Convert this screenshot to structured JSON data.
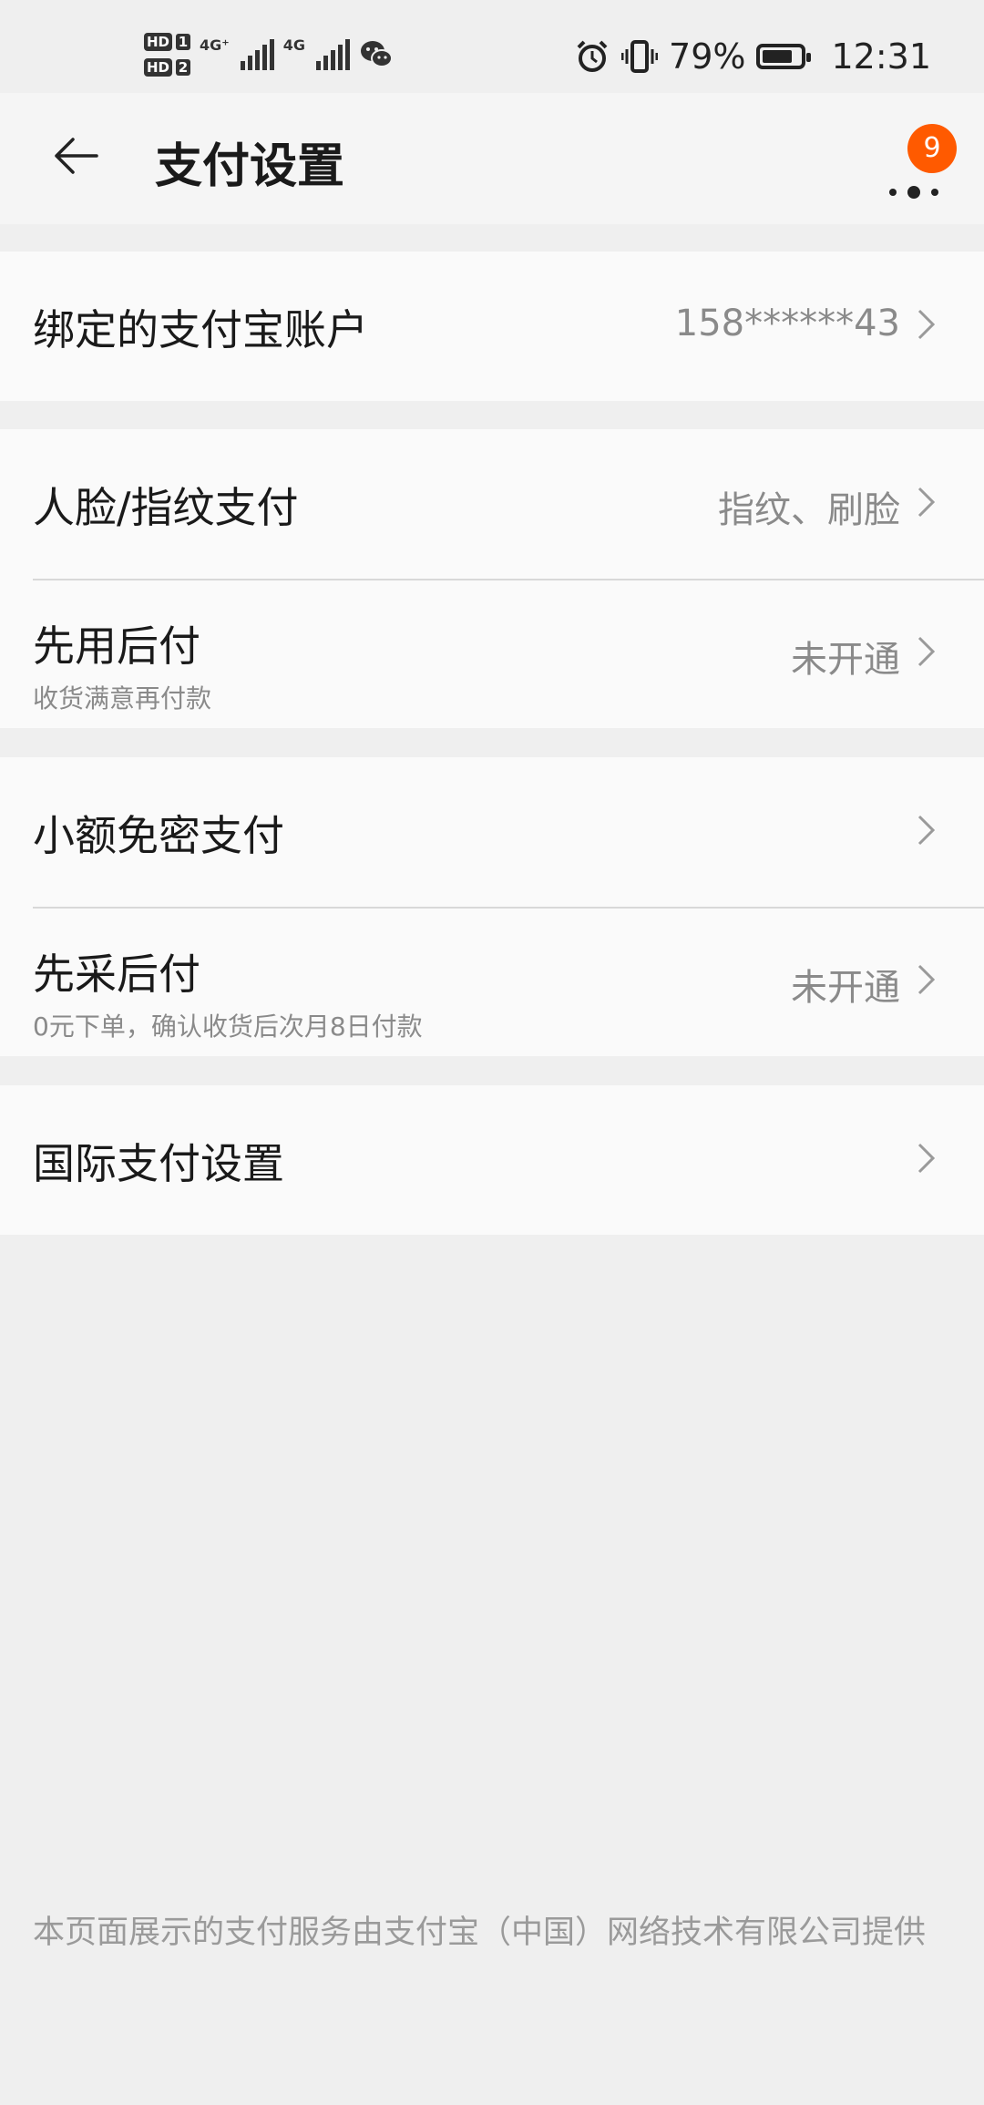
{
  "status_bar": {
    "sim1_label": "HD",
    "sim1_num": "1",
    "sim2_label": "HD",
    "sim2_num": "2",
    "net1": "4G⁺",
    "net2": "4G",
    "battery_percent": "79%",
    "battery_level": 0.79,
    "time": "12:31"
  },
  "header": {
    "title": "支付设置",
    "more_badge": "9"
  },
  "settings": {
    "alipay_account": {
      "label": "绑定的支付宝账户",
      "value": "158******43"
    },
    "biometric_pay": {
      "label": "人脸/指纹支付",
      "value": "指纹、刷脸"
    },
    "pay_later": {
      "label": "先用后付",
      "subtitle": "收货满意再付款",
      "value": "未开通"
    },
    "small_amount": {
      "label": "小额免密支付",
      "value": ""
    },
    "purchase_later": {
      "label": "先采后付",
      "subtitle": "0元下单，确认收货后次月8日付款",
      "value": "未开通"
    },
    "international": {
      "label": "国际支付设置",
      "value": ""
    }
  },
  "footer": {
    "note": "本页面展示的支付服务由支付宝（中国）网络技术有限公司提供"
  },
  "colors": {
    "background": "#efefef",
    "card": "#fafafa",
    "badge": "#ff5a00",
    "secondary_text": "#8a8a8a"
  }
}
